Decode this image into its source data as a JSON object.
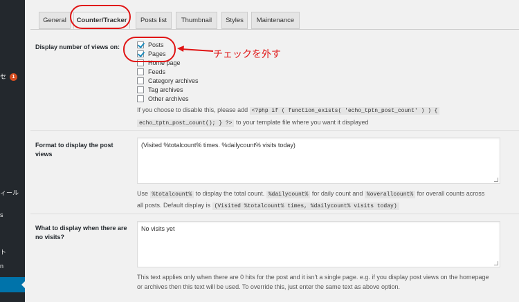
{
  "sidebar": {
    "items": [
      "セ",
      "ィール",
      "s",
      "ト",
      "n"
    ],
    "badge": "1"
  },
  "tabs": [
    "General",
    "Counter/Tracker",
    "Posts list",
    "Thumbnail",
    "Styles",
    "Maintenance"
  ],
  "display_views": {
    "label": "Display number of views on:",
    "options": [
      {
        "label": "Posts",
        "checked": true
      },
      {
        "label": "Pages",
        "checked": true
      },
      {
        "label": "Home page",
        "checked": false
      },
      {
        "label": "Feeds",
        "checked": false
      },
      {
        "label": "Category archives",
        "checked": false
      },
      {
        "label": "Tag archives",
        "checked": false
      },
      {
        "label": "Other archives",
        "checked": false
      }
    ],
    "desc_pre": "If you choose to disable this, please add",
    "code1": "<?php if ( function_exists( 'echo_tptn_post_count' ) ) {",
    "code2": "echo_tptn_post_count(); } ?>",
    "desc_post": "to your template file where you want it displayed"
  },
  "format": {
    "label_line1": "Format to display the post",
    "label_line2": "views",
    "value": "(Visited %totalcount% times. %dailycount% visits today)",
    "help_use": "Use",
    "code_total": "%totalcount%",
    "help_total": "to display the total count.",
    "code_daily": "%dailycount%",
    "help_daily": "for daily count and",
    "code_overall": "%overallcount%",
    "help_overall": "for overall counts across",
    "help_line2_pre": "all posts. Default display is",
    "code_default": "(Visited %totalcount% times, %dailycount% visits today)"
  },
  "no_visits": {
    "label_line1": "What to display when there are",
    "label_line2": "no visits?",
    "value": "No visits yet",
    "help_line1": "This text applies only when there are 0 hits for the post and it isn't a single page. e.g. if you display post views on the homepage",
    "help_line2": "or archives then this text will be used. To override this, just enter the same text as above option."
  },
  "annotation": {
    "text": "チェックを外す",
    "color": "#e01414"
  },
  "colors": {
    "sidebar": "#23282d",
    "active_menu": "#0073aa",
    "badge": "#d54e21",
    "checkmark": "#1e8cbe"
  }
}
